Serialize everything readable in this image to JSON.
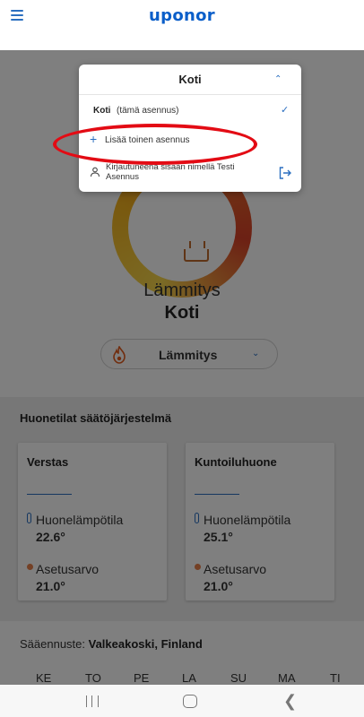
{
  "header": {
    "logo": "uponor"
  },
  "main": {
    "mode_title": "Lämmitys",
    "home_title": "Koti",
    "mode_select": {
      "label": "Lämmitys"
    }
  },
  "zones": {
    "title": "Huonetilat säätöjärjestelmä",
    "items": [
      {
        "name": "Verstas",
        "temp_label": "Huonelämpötila",
        "temp_value": "22.6°",
        "setpoint_label": "Asetusarvo",
        "setpoint_value": "21.0°"
      },
      {
        "name": "Kuntoiluhuone",
        "temp_label": "Huonelämpötila",
        "temp_value": "25.1°",
        "setpoint_label": "Asetusarvo",
        "setpoint_value": "21.0°"
      }
    ]
  },
  "forecast": {
    "label": "Sääennuste: ",
    "location": "Valkeakoski, Finland",
    "days": [
      "KE",
      "TO",
      "PE",
      "LA",
      "SU",
      "MA",
      "TI"
    ]
  },
  "dropdown": {
    "title": "Koti",
    "current_bold": "Koti",
    "current_note": "(tämä asennus)",
    "add_label": "Lisää toinen asennus",
    "logged_in": "Kirjautuneena sisään nimellä Testi Asennus"
  },
  "colors": {
    "brand": "#0a5ec9",
    "accent": "#2b6fc0",
    "highlight": "#e30b14"
  },
  "icons": {
    "menu": "hamburger-menu-icon",
    "flame": "flame-icon",
    "thermometer": "thermometer-icon",
    "check": "checkmark-icon",
    "person": "person-icon",
    "logout": "logout-icon"
  }
}
